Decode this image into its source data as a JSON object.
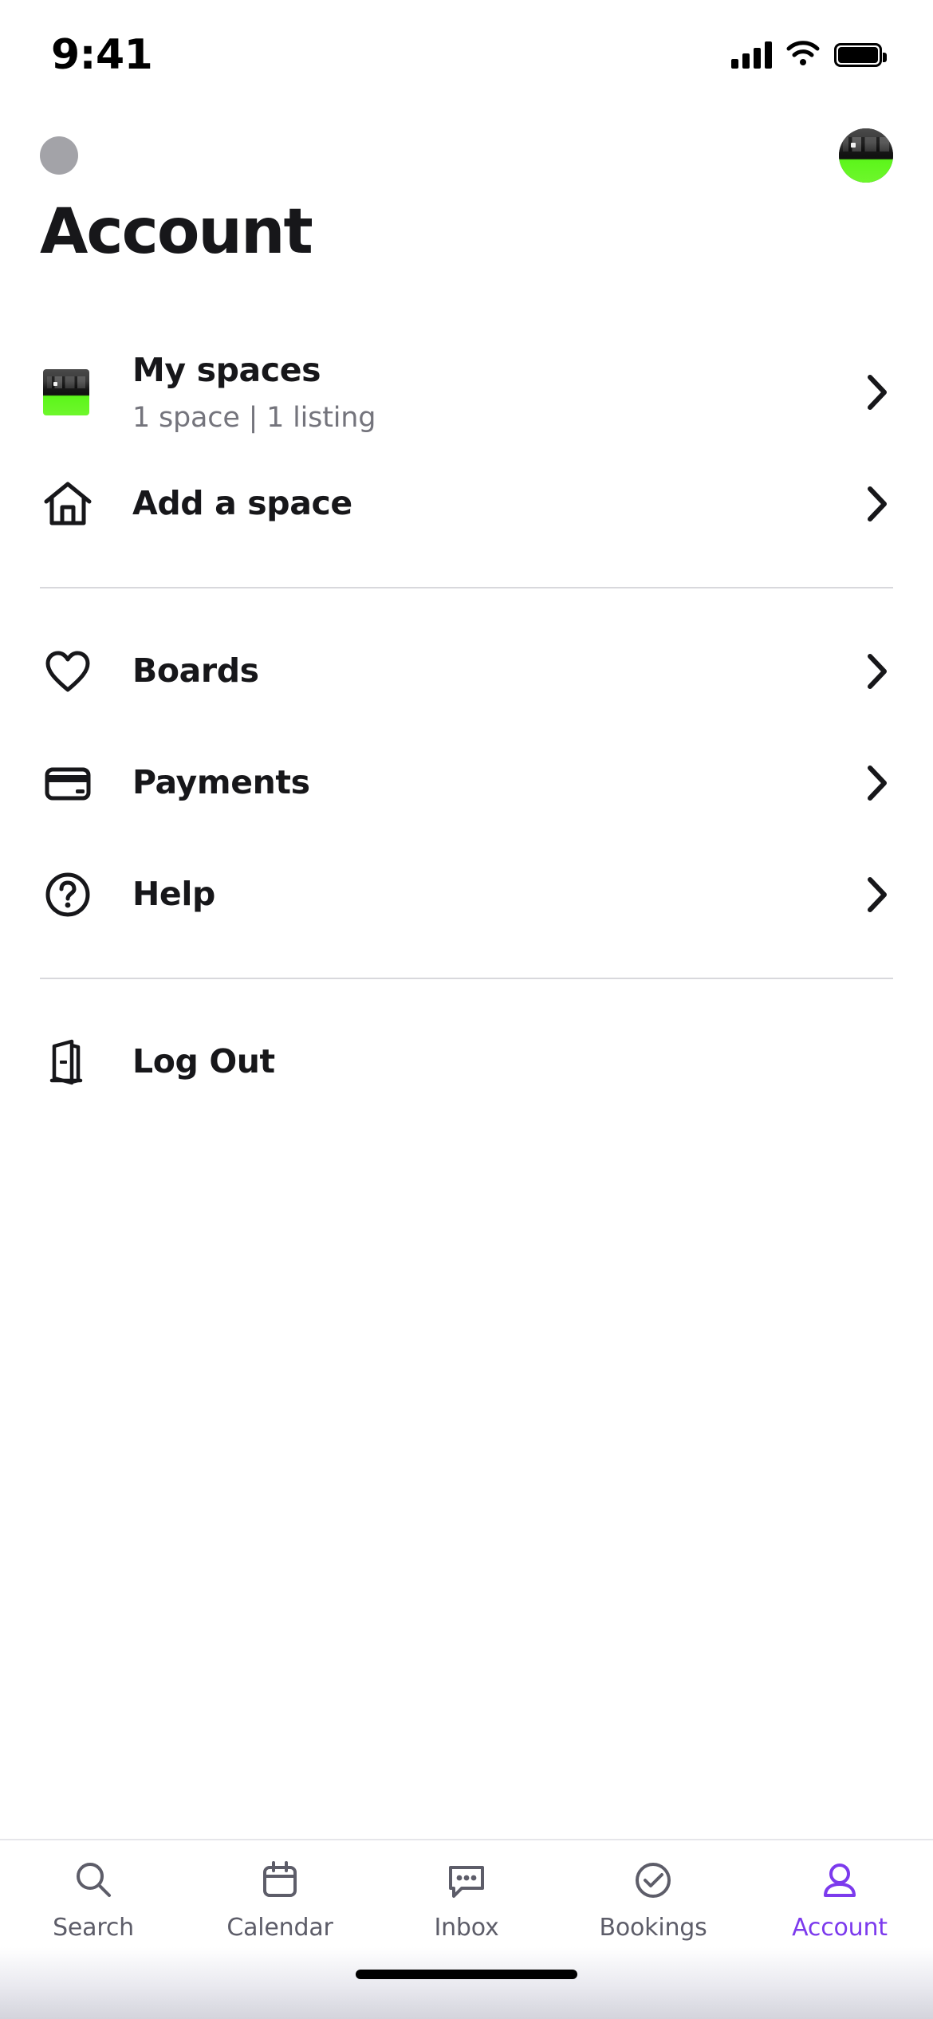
{
  "status_bar": {
    "time": "9:41",
    "signal_icon": "cellular-signal-icon",
    "wifi_icon": "wifi-icon",
    "battery_icon": "battery-full-icon"
  },
  "header": {
    "left_placeholder_name": "profile-placeholder-dot",
    "avatar_name": "user-avatar",
    "title": "Account"
  },
  "menu": {
    "sections": [
      {
        "rows": [
          {
            "id": "my-spaces",
            "icon": "space-thumbnail",
            "title": "My spaces",
            "subtitle": "1 space | 1 listing",
            "chevron": true
          },
          {
            "id": "add-a-space",
            "icon": "home-icon",
            "title": "Add a space",
            "subtitle": "",
            "chevron": true
          }
        ]
      },
      {
        "rows": [
          {
            "id": "boards",
            "icon": "heart-icon",
            "title": "Boards",
            "subtitle": "",
            "chevron": true
          },
          {
            "id": "payments",
            "icon": "credit-card-icon",
            "title": "Payments",
            "subtitle": "",
            "chevron": true
          },
          {
            "id": "help",
            "icon": "question-circle-icon",
            "title": "Help",
            "subtitle": "",
            "chevron": true
          }
        ]
      },
      {
        "rows": [
          {
            "id": "log-out",
            "icon": "door-exit-icon",
            "title": "Log Out",
            "subtitle": "",
            "chevron": false
          }
        ]
      }
    ]
  },
  "tab_bar": {
    "active_index": 4,
    "active_color": "#7c3aed",
    "inactive_color": "#5d5d69",
    "tabs": [
      {
        "id": "search",
        "label": "Search",
        "icon": "search-icon"
      },
      {
        "id": "calendar",
        "label": "Calendar",
        "icon": "calendar-icon"
      },
      {
        "id": "inbox",
        "label": "Inbox",
        "icon": "chat-bubble-icon"
      },
      {
        "id": "bookings",
        "label": "Bookings",
        "icon": "check-circle-icon"
      },
      {
        "id": "account",
        "label": "Account",
        "icon": "person-icon"
      }
    ]
  },
  "home_indicator": {
    "name": "home-indicator"
  }
}
